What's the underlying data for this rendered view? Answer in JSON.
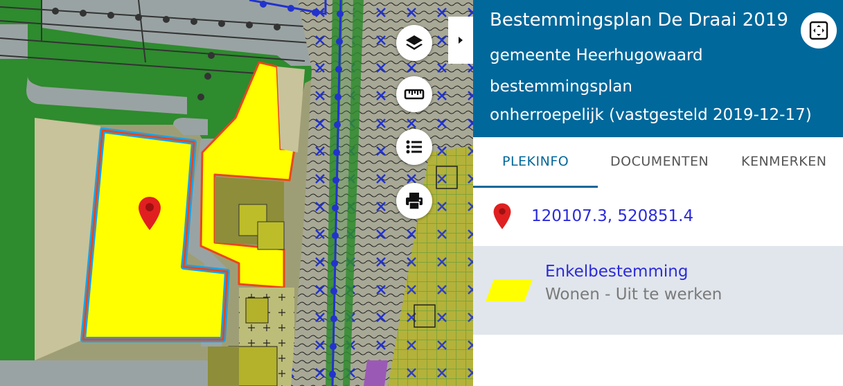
{
  "map": {
    "colors": {
      "background": "#9e9e76",
      "green": "#2e8b2e",
      "road": "#9aa3a3",
      "residential": "#c8c39a",
      "yellow_plot": "#ffff00",
      "plot_border": "#e8471c",
      "selection_outline": "#1aa3e8",
      "water_line": "#2233cc",
      "olive": "#8d8d3a"
    },
    "marker": {
      "icon": "location-pin-icon",
      "color": "#e02020"
    },
    "controls": [
      {
        "name": "layers-button",
        "icon": "layers-icon"
      },
      {
        "name": "measure-button",
        "icon": "ruler-icon"
      },
      {
        "name": "legend-button",
        "icon": "list-icon"
      },
      {
        "name": "print-button",
        "icon": "printer-icon"
      }
    ],
    "collapse_tab_icon": "caret-right-icon"
  },
  "panel": {
    "title": "Bestemmingsplan De Draai 2019",
    "municipality": "gemeente Heerhugowaard",
    "plan_type": "bestemmingsplan",
    "status": "onherroepelijk (vastgesteld 2019-12-17)",
    "header_color": "#01689b",
    "expand_icon": "expand-icon",
    "tabs": [
      {
        "label": "PLEKINFO",
        "active": true
      },
      {
        "label": "DOCUMENTEN",
        "active": false
      },
      {
        "label": "KENMERKEN",
        "active": false
      }
    ],
    "coordinates": "120107.3, 520851.4",
    "result": {
      "title": "Enkelbestemming",
      "subtitle": "Wonen - Uit te werken",
      "swatch_color": "#ffff00"
    }
  }
}
